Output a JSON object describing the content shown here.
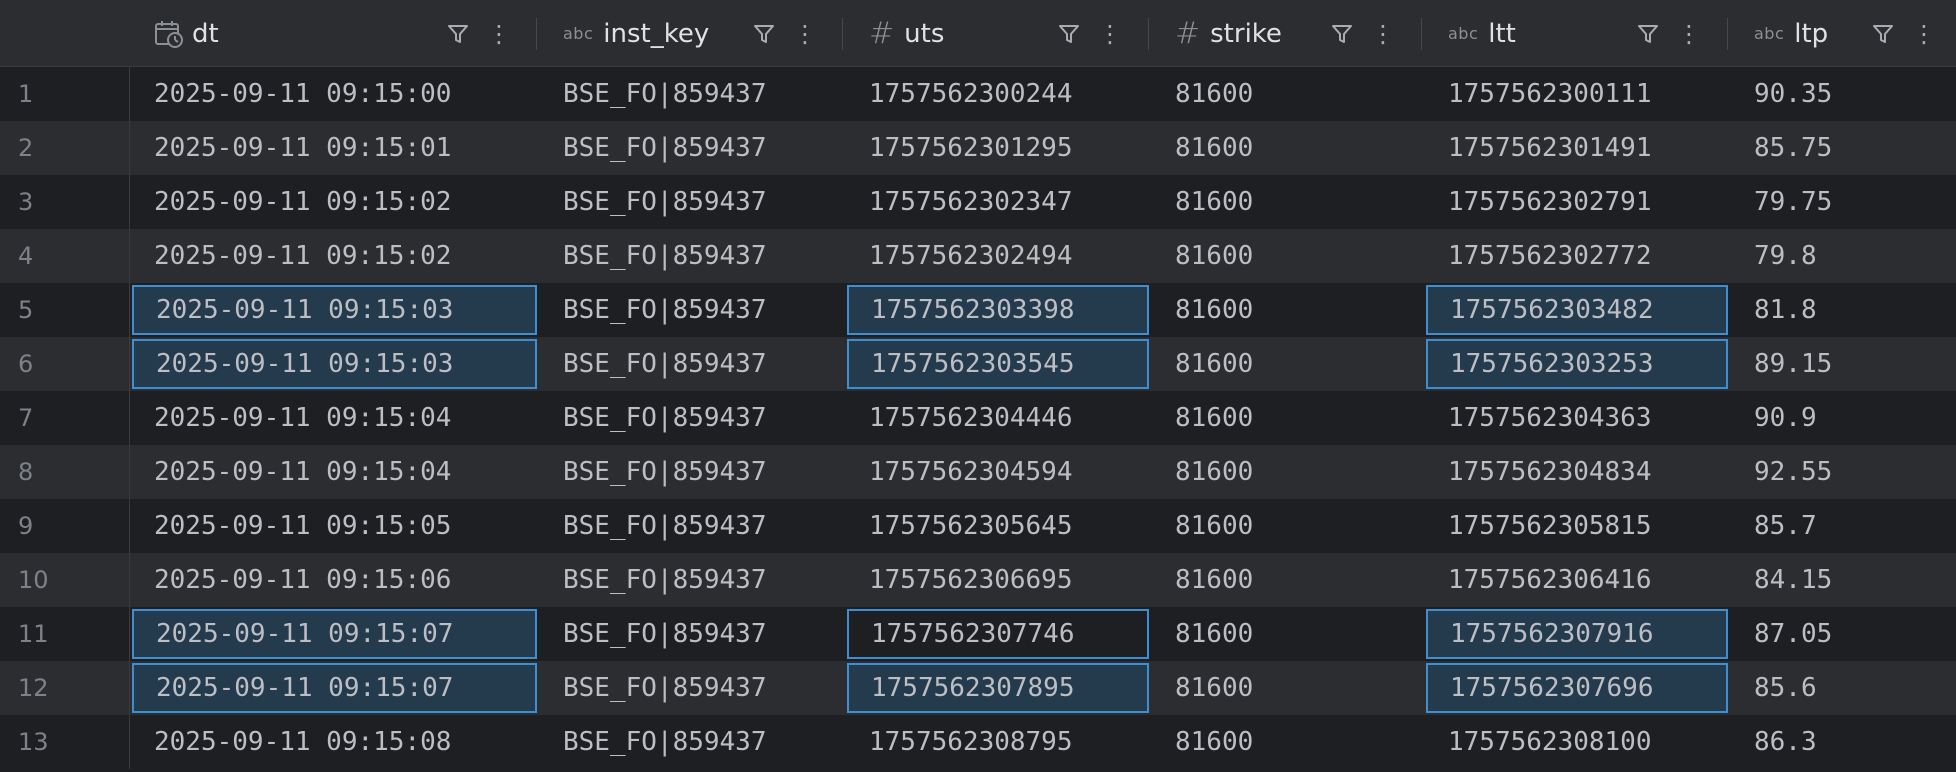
{
  "columns": [
    {
      "key": "dt",
      "label": "dt",
      "type_icon": "calendar-clock-icon"
    },
    {
      "key": "inst_key",
      "label": "inst_key",
      "type_icon": "abc",
      "type_label": "abc"
    },
    {
      "key": "uts",
      "label": "uts",
      "type_icon": "hash-icon",
      "type_label": "#"
    },
    {
      "key": "strike",
      "label": "strike",
      "type_icon": "hash-icon",
      "type_label": "#"
    },
    {
      "key": "ltt",
      "label": "ltt",
      "type_icon": "abc",
      "type_label": "abc"
    },
    {
      "key": "ltp",
      "label": "ltp",
      "type_icon": "abc",
      "type_label": "abc"
    }
  ],
  "rows": [
    {
      "num": "1",
      "dt": "2025-09-11 09:15:00",
      "inst_key": "BSE_FO|859437",
      "uts": "1757562300244",
      "strike": "81600",
      "ltt": "1757562300111",
      "ltp": "90.35"
    },
    {
      "num": "2",
      "dt": "2025-09-11 09:15:01",
      "inst_key": "BSE_FO|859437",
      "uts": "1757562301295",
      "strike": "81600",
      "ltt": "1757562301491",
      "ltp": "85.75"
    },
    {
      "num": "3",
      "dt": "2025-09-11 09:15:02",
      "inst_key": "BSE_FO|859437",
      "uts": "1757562302347",
      "strike": "81600",
      "ltt": "1757562302791",
      "ltp": "79.75"
    },
    {
      "num": "4",
      "dt": "2025-09-11 09:15:02",
      "inst_key": "BSE_FO|859437",
      "uts": "1757562302494",
      "strike": "81600",
      "ltt": "1757562302772",
      "ltp": "79.8"
    },
    {
      "num": "5",
      "dt": "2025-09-11 09:15:03",
      "inst_key": "BSE_FO|859437",
      "uts": "1757562303398",
      "strike": "81600",
      "ltt": "1757562303482",
      "ltp": "81.8"
    },
    {
      "num": "6",
      "dt": "2025-09-11 09:15:03",
      "inst_key": "BSE_FO|859437",
      "uts": "1757562303545",
      "strike": "81600",
      "ltt": "1757562303253",
      "ltp": "89.15"
    },
    {
      "num": "7",
      "dt": "2025-09-11 09:15:04",
      "inst_key": "BSE_FO|859437",
      "uts": "1757562304446",
      "strike": "81600",
      "ltt": "1757562304363",
      "ltp": "90.9"
    },
    {
      "num": "8",
      "dt": "2025-09-11 09:15:04",
      "inst_key": "BSE_FO|859437",
      "uts": "1757562304594",
      "strike": "81600",
      "ltt": "1757562304834",
      "ltp": "92.55"
    },
    {
      "num": "9",
      "dt": "2025-09-11 09:15:05",
      "inst_key": "BSE_FO|859437",
      "uts": "1757562305645",
      "strike": "81600",
      "ltt": "1757562305815",
      "ltp": "85.7"
    },
    {
      "num": "10",
      "dt": "2025-09-11 09:15:06",
      "inst_key": "BSE_FO|859437",
      "uts": "1757562306695",
      "strike": "81600",
      "ltt": "1757562306416",
      "ltp": "84.15"
    },
    {
      "num": "11",
      "dt": "2025-09-11 09:15:07",
      "inst_key": "BSE_FO|859437",
      "uts": "1757562307746",
      "strike": "81600",
      "ltt": "1757562307916",
      "ltp": "87.05"
    },
    {
      "num": "12",
      "dt": "2025-09-11 09:15:07",
      "inst_key": "BSE_FO|859437",
      "uts": "1757562307895",
      "strike": "81600",
      "ltt": "1757562307696",
      "ltp": "85.6"
    },
    {
      "num": "13",
      "dt": "2025-09-11 09:15:08",
      "inst_key": "BSE_FO|859437",
      "uts": "1757562308795",
      "strike": "81600",
      "ltt": "1757562308100",
      "ltp": "86.3"
    }
  ],
  "selection": {
    "filled": [
      [
        5,
        "dt"
      ],
      [
        5,
        "uts"
      ],
      [
        5,
        "ltt"
      ],
      [
        6,
        "dt"
      ],
      [
        6,
        "uts"
      ],
      [
        6,
        "ltt"
      ],
      [
        11,
        "dt"
      ],
      [
        11,
        "ltt"
      ],
      [
        12,
        "dt"
      ],
      [
        12,
        "uts"
      ],
      [
        12,
        "ltt"
      ]
    ],
    "focused_outline": [
      [
        11,
        "uts"
      ]
    ]
  },
  "colors": {
    "background": "#1e1f22",
    "alt_row": "#2b2d30",
    "selection_fill": "#243a4d",
    "selection_border": "#3d8fd1",
    "text": "#bcbec4"
  }
}
